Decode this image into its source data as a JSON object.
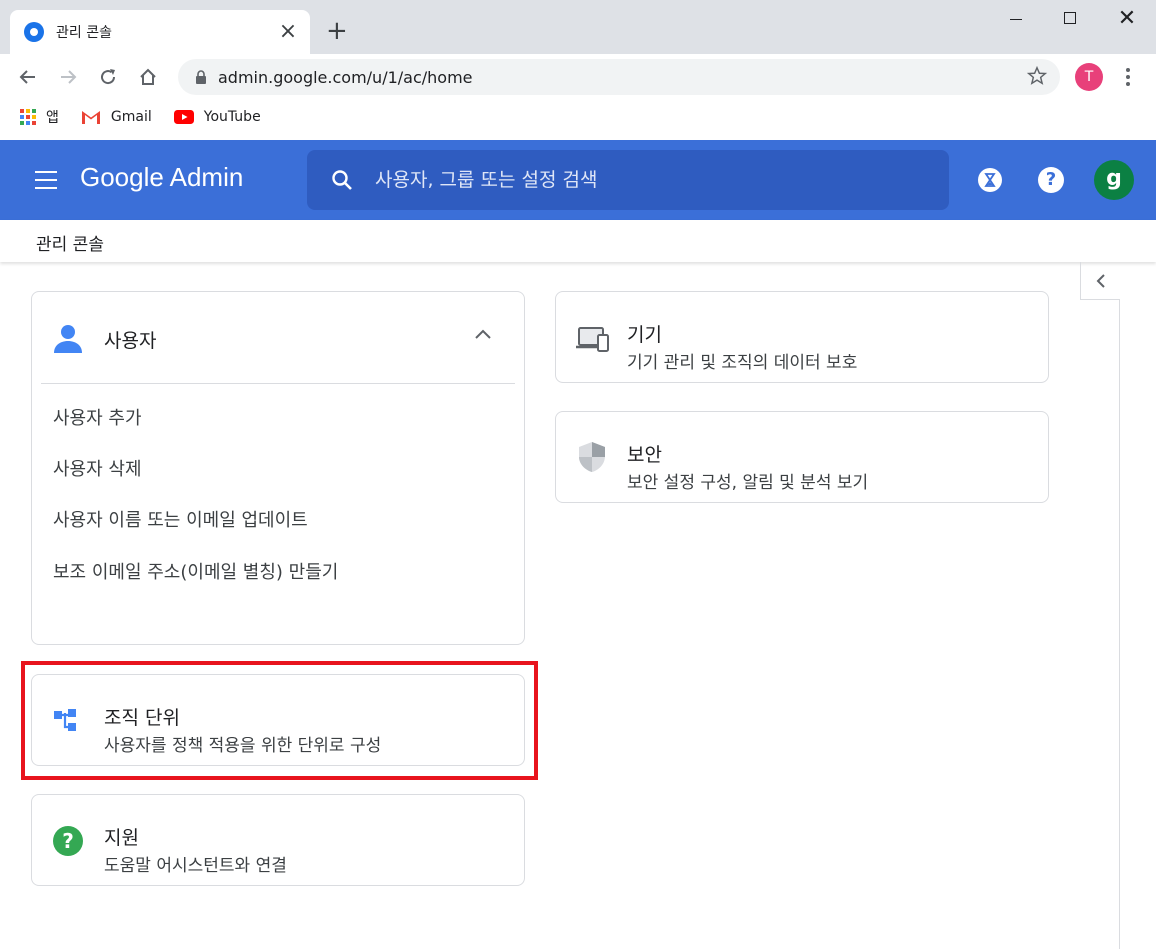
{
  "browser": {
    "tab_title": "관리 콘솔",
    "url": "admin.google.com/u/1/ac/home",
    "profile_initial": "T",
    "bookmarks": [
      {
        "label": "앱",
        "icon": "apps-grid-icon"
      },
      {
        "label": "Gmail",
        "icon": "gmail-icon"
      },
      {
        "label": "YouTube",
        "icon": "youtube-icon"
      }
    ]
  },
  "appbar": {
    "brand": "Google Admin",
    "search_placeholder": "사용자, 그룹 또는 설정 검색",
    "account_initial": "g",
    "bar_color": "#3b6fd8",
    "avatar_color": "#0b8043"
  },
  "breadcrumb": "관리 콘솔",
  "cards": {
    "users": {
      "title": "사용자",
      "links": [
        "사용자 추가",
        "사용자 삭제",
        "사용자 이름 또는 이메일 업데이트",
        "보조 이메일 주소(이메일 별칭) 만들기"
      ]
    },
    "org_units": {
      "title": "조직 단위",
      "subtitle": "사용자를 정책 적용을 위한 단위로 구성"
    },
    "support": {
      "title": "지원",
      "subtitle": "도움말 어시스턴트와 연결"
    },
    "devices": {
      "title": "기기",
      "subtitle": "기기 관리 및 조직의 데이터 보호"
    },
    "security": {
      "title": "보안",
      "subtitle": "보안 설정 구성, 알림 및 분석 보기"
    }
  },
  "highlight_color": "#e8141d"
}
